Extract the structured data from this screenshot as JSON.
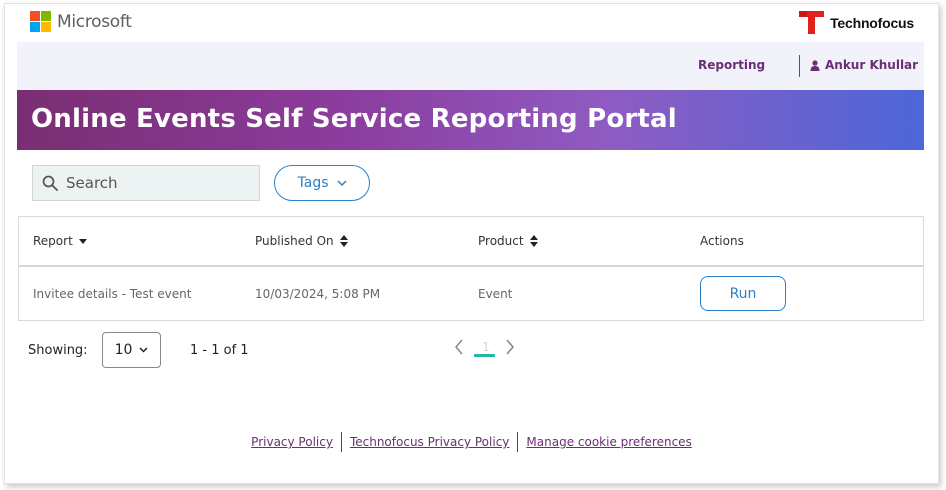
{
  "brand": {
    "microsoft_name": "Microsoft",
    "microsoft_colors": [
      "#f25022",
      "#7fba00",
      "#00a4ef",
      "#ffb900"
    ],
    "technofocus_name": "Technofocus",
    "technofocus_mark_color": "#e2211c"
  },
  "nav": {
    "reporting_label": "Reporting",
    "user_icon": "user-icon",
    "user_name": "Ankur Khullar"
  },
  "banner": {
    "title": "Online Events Self Service Reporting Portal",
    "gradient_colors": [
      "#7a2e72",
      "#8b3c9c",
      "#8f5bc2",
      "#4d67d9"
    ]
  },
  "filters": {
    "search_icon": "search-icon",
    "search_placeholder": "Search",
    "tags_label": "Tags"
  },
  "table": {
    "columns": [
      {
        "label": "Report",
        "sort_icon": "caret-down-icon"
      },
      {
        "label": "Published On",
        "sort_icon": "sort-icon"
      },
      {
        "label": "Product",
        "sort_icon": "sort-icon"
      },
      {
        "label": "Actions",
        "sort_icon": ""
      }
    ],
    "rows": [
      {
        "report": "Invitee details - Test event",
        "published_on": "10/03/2024, 5:08 PM",
        "product": "Event",
        "action_label": "Run"
      }
    ]
  },
  "pagination": {
    "showing_label": "Showing:",
    "page_size": "10",
    "range": "1 - 1 of 1",
    "current_page": "1",
    "active_color": "#1fb8a0"
  },
  "footer": {
    "links": [
      "Privacy Policy",
      "Technofocus Privacy Policy",
      "Manage cookie preferences"
    ]
  },
  "colors": {
    "accent_purple": "#6b2e73",
    "accent_blue": "#2f7fc4"
  }
}
